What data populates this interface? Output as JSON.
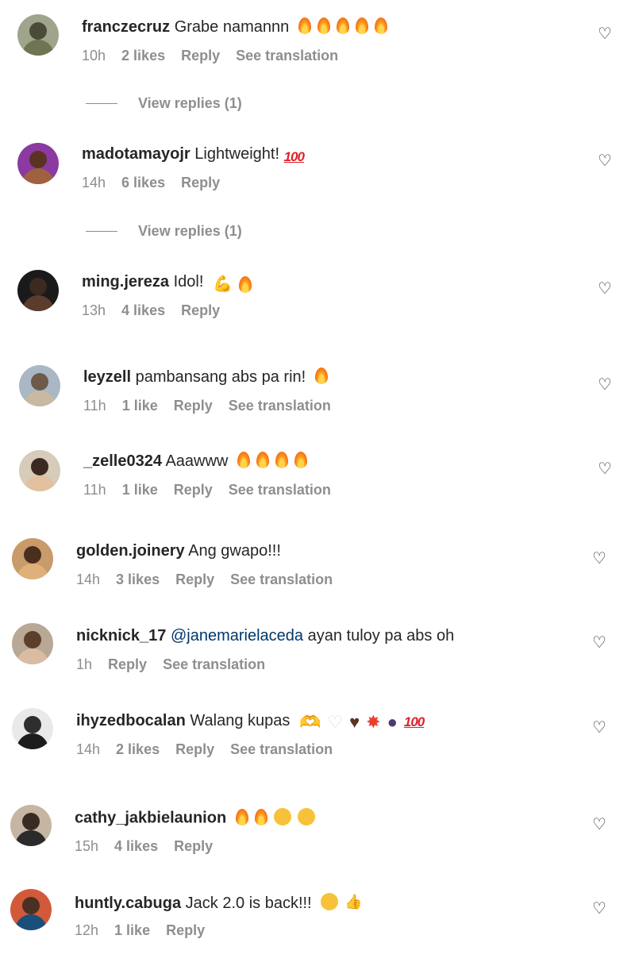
{
  "comments": [
    {
      "username": "franczecruz",
      "text": "Grabe namannn",
      "emojis": [
        "fire",
        "fire",
        "fire",
        "fire",
        "fire"
      ],
      "time": "10h",
      "likes": "2 likes",
      "reply": "Reply",
      "translate": "See translation",
      "view_replies": "View replies (1)"
    },
    {
      "username": "madotamayojr",
      "text": "Lightweight!",
      "emojis": [
        "hundred"
      ],
      "time": "14h",
      "likes": "6 likes",
      "reply": "Reply",
      "view_replies": "View replies (1)"
    },
    {
      "username": "ming.jereza",
      "text": "Idol!",
      "emojis": [
        "muscle",
        "fire"
      ],
      "time": "13h",
      "likes": "4 likes",
      "reply": "Reply"
    },
    {
      "username": "leyzell",
      "text": "pambansang abs pa rin!",
      "emojis": [
        "fire"
      ],
      "time": "11h",
      "likes": "1 like",
      "reply": "Reply",
      "translate": "See translation"
    },
    {
      "username": "_zelle0324",
      "text": "Aaawww",
      "emojis": [
        "fire",
        "fire",
        "fire",
        "fire"
      ],
      "time": "11h",
      "likes": "1 like",
      "reply": "Reply",
      "translate": "See translation"
    },
    {
      "username": "golden.joinery",
      "text": "Ang gwapo!!!",
      "emojis": [],
      "time": "14h",
      "likes": "3 likes",
      "reply": "Reply",
      "translate": "See translation"
    },
    {
      "username": "nicknick_17",
      "mention": "@janemarielaceda",
      "text": "ayan tuloy pa abs oh",
      "emojis": [],
      "time": "1h",
      "reply": "Reply",
      "translate": "See translation"
    },
    {
      "username": "ihyzedbocalan",
      "text": "Walang kupas",
      "emojis": [
        "handheart",
        "whiteheart",
        "brownheart",
        "collision",
        "bomb",
        "hundred"
      ],
      "time": "14h",
      "likes": "2 likes",
      "reply": "Reply",
      "translate": "See translation"
    },
    {
      "username": "cathy_jakbielaunion",
      "text": "",
      "emojis": [
        "fire",
        "fire",
        "hearteyes",
        "hearteyes"
      ],
      "time": "15h",
      "likes": "4 likes",
      "reply": "Reply"
    },
    {
      "username": "huntly.cabuga",
      "text": "Jack 2.0 is back!!!",
      "emojis": [
        "sunglasses",
        "thumbsup"
      ],
      "time": "12h",
      "likes": "1 like",
      "reply": "Reply"
    }
  ],
  "colors": {
    "text": "#262626",
    "meta": "#8e8e8e",
    "mention": "#00376b",
    "background": "#ffffff"
  },
  "icons": {
    "like": "heart-outline-icon"
  }
}
